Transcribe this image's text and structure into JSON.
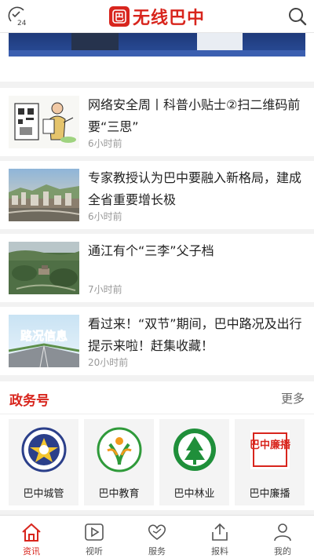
{
  "header": {
    "brand_name": "无线巴中",
    "brand_mark": "巴",
    "badge_number": "24",
    "brand_color": "#d8251d"
  },
  "news": [
    {
      "title": "网络安全周丨科普小贴士②扫二维码前要“三思”",
      "time": "6小时前",
      "thumb": "cartoon-illustration"
    },
    {
      "title": "专家教授认为巴中要融入新格局，建成全省重要增长极",
      "time": "6小时前",
      "thumb": "city-skyline"
    },
    {
      "title": "通江有个“三李”父子档",
      "time": "7小时前",
      "thumb": "aerial-village"
    },
    {
      "title": "看过来！“双节”期间，巴中路况及出行提示来啦！赶集收藏！",
      "time": "20小时前",
      "thumb": "road-info",
      "thumb_text": "路况信息"
    }
  ],
  "section": {
    "title": "政务号",
    "more": "更多",
    "accounts": [
      {
        "name": "巴中城管",
        "icon": "city-management-emblem-icon"
      },
      {
        "name": "巴中教育",
        "icon": "education-logo-icon"
      },
      {
        "name": "巴中林业",
        "icon": "forestry-logo-icon"
      },
      {
        "name": "巴中廉播",
        "icon": "lianbo-seal-icon",
        "seal_text": "巴中廉播"
      }
    ]
  },
  "tabs": [
    {
      "label": "资讯",
      "icon": "home-icon",
      "active": true
    },
    {
      "label": "视听",
      "icon": "play-icon",
      "active": false
    },
    {
      "label": "服务",
      "icon": "heart-icon",
      "active": false
    },
    {
      "label": "报料",
      "icon": "share-upload-icon",
      "active": false
    },
    {
      "label": "我的",
      "icon": "user-icon",
      "active": false
    }
  ]
}
